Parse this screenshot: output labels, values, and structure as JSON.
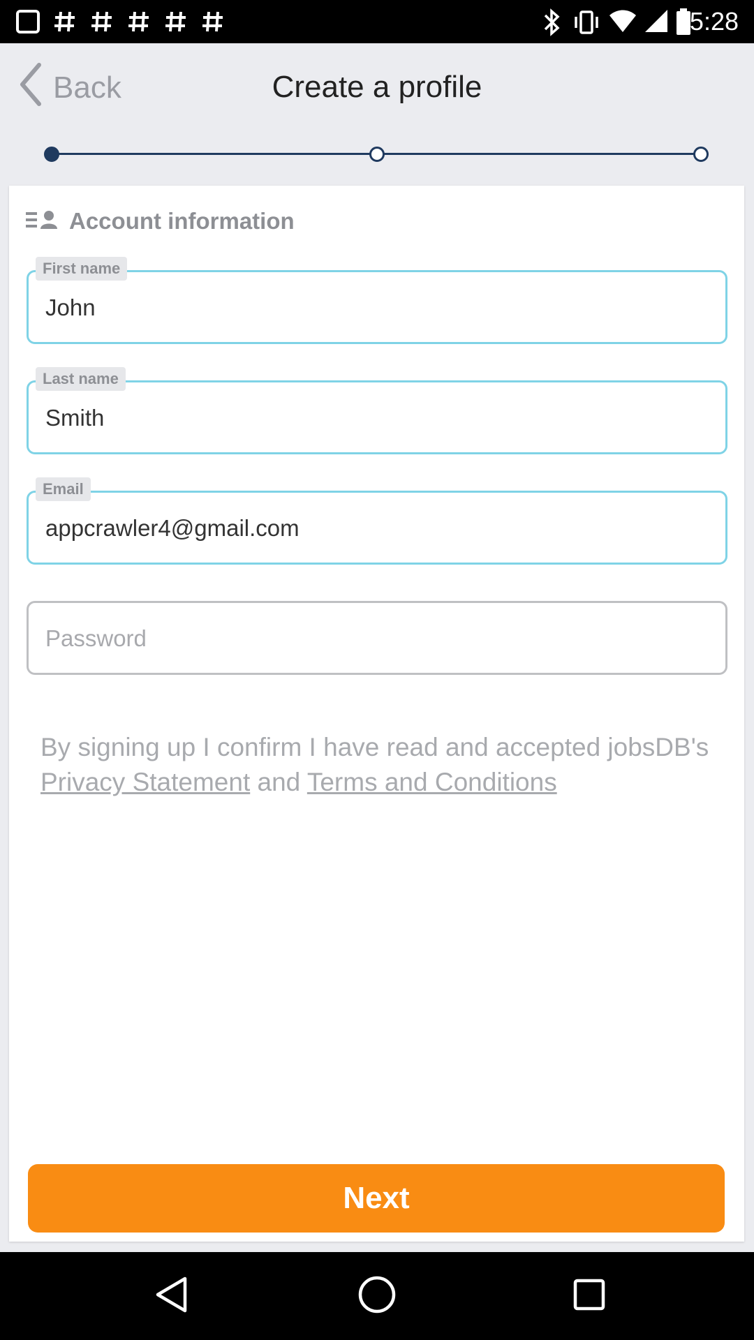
{
  "status_bar": {
    "time": "5:28"
  },
  "header": {
    "back_label": "Back",
    "title": "Create a profile"
  },
  "progress": {
    "steps": 3,
    "current_step": 1
  },
  "section": {
    "title": "Account information"
  },
  "form": {
    "first_name": {
      "label": "First name",
      "value": "John"
    },
    "last_name": {
      "label": "Last name",
      "value": "Smith"
    },
    "email": {
      "label": "Email",
      "value": "appcrawler4@gmail.com"
    },
    "password": {
      "placeholder": "Password"
    }
  },
  "terms": {
    "prefix": "By signing up I confirm I have read and accepted jobsDB's ",
    "privacy_link": "Privacy Statement",
    "middle": " and ",
    "terms_link": "Terms and Conditions"
  },
  "next_button": {
    "label": "Next"
  },
  "colors": {
    "accent": "#f98c13",
    "field_focus_border": "#7fd3e6",
    "progress": "#1f3a5f"
  }
}
